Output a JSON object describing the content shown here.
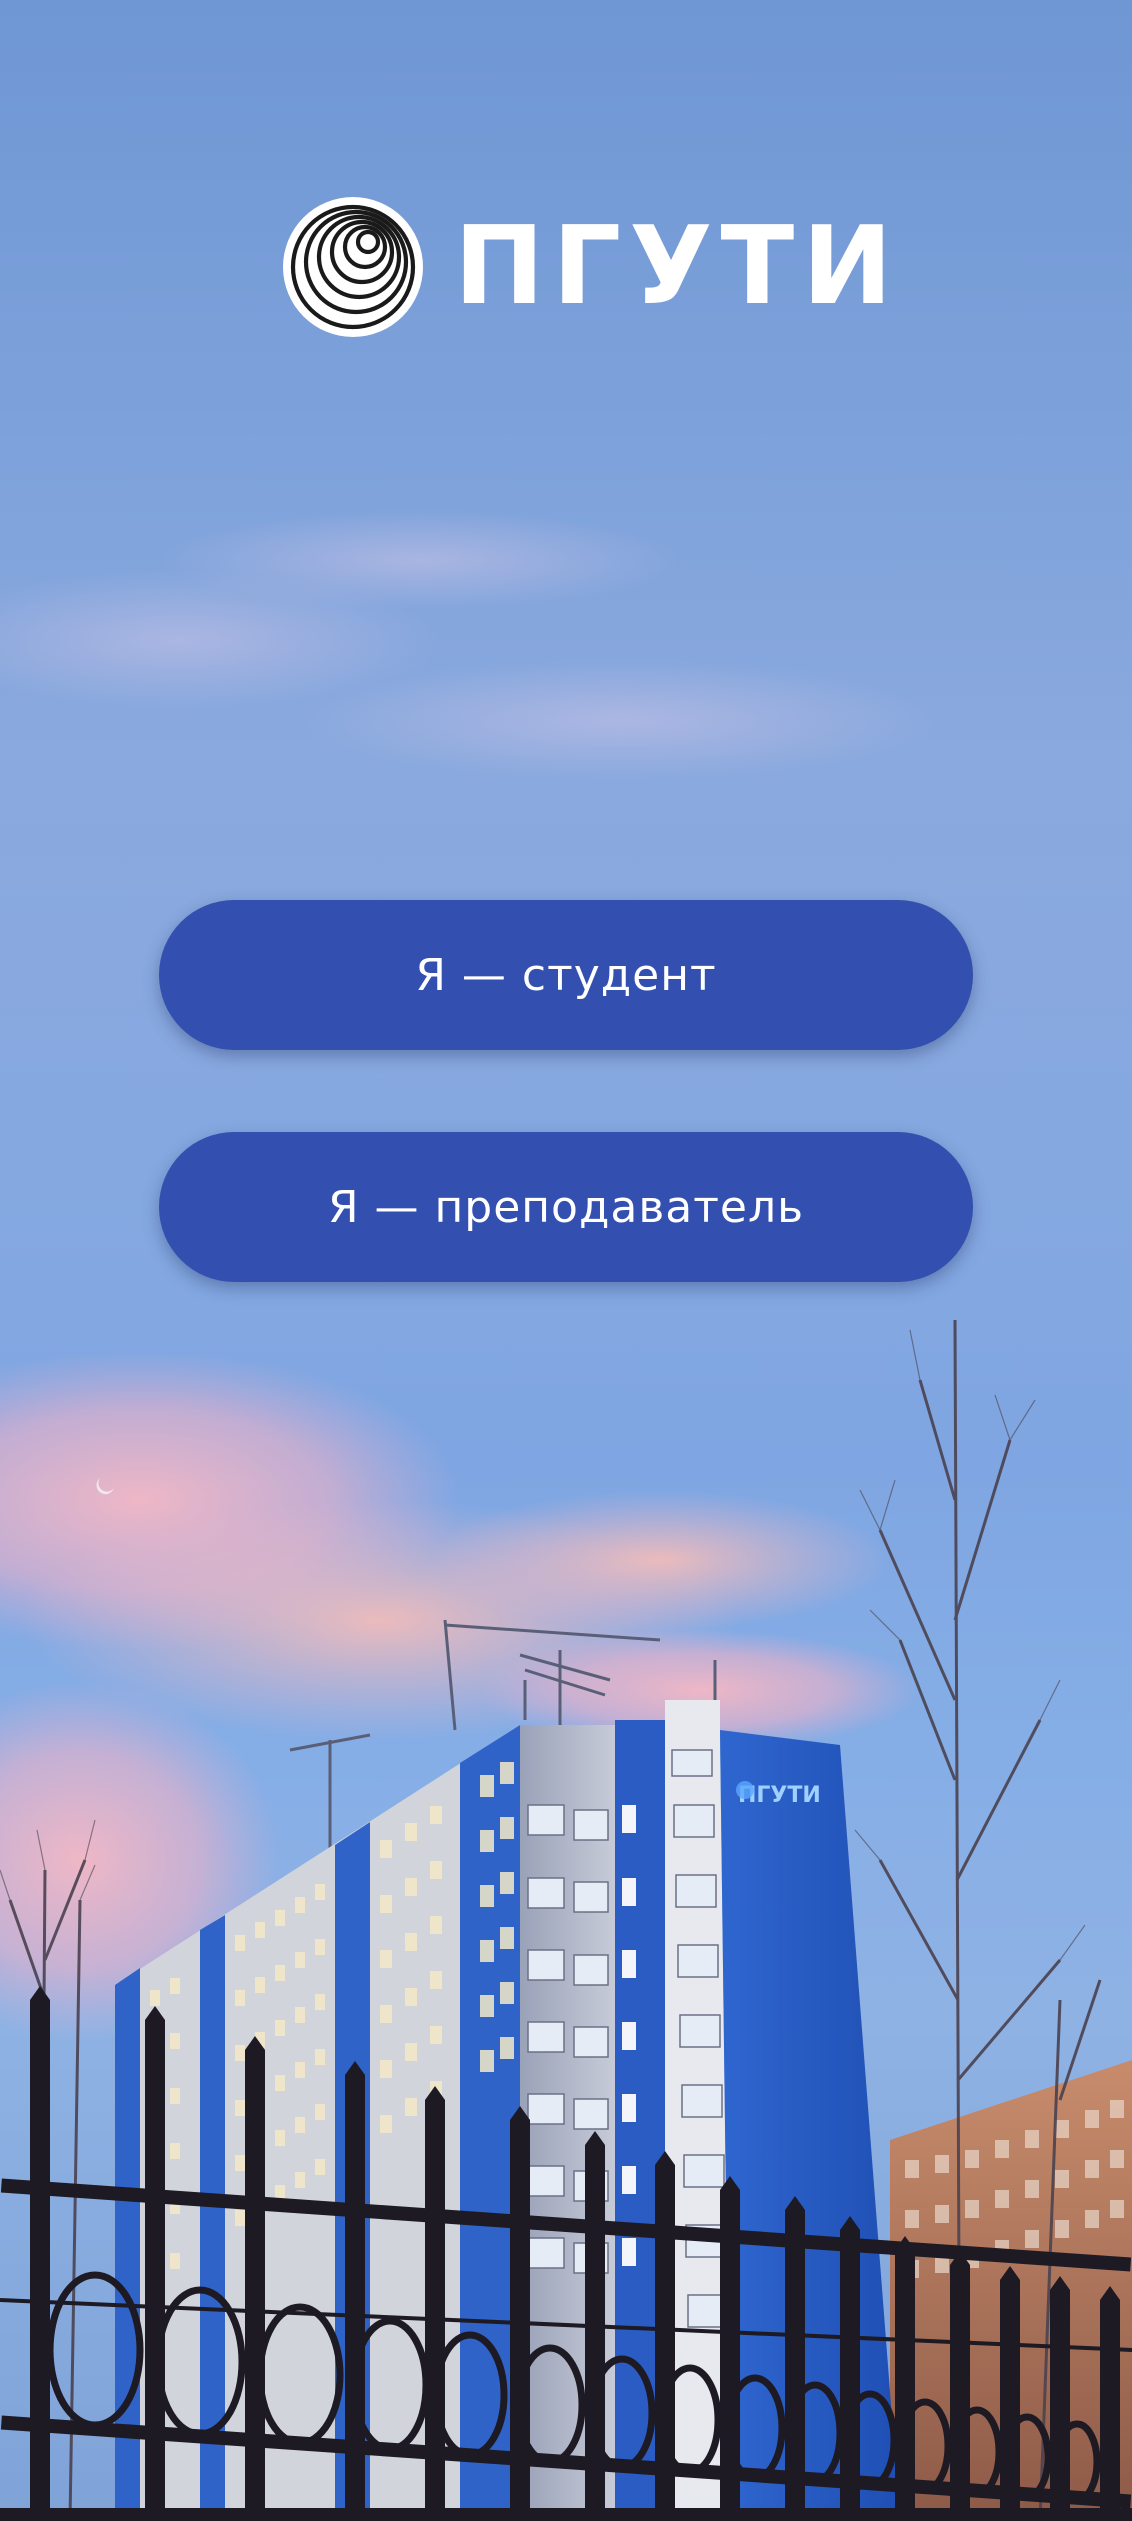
{
  "app": {
    "logo_text": "ПГУТИ",
    "building_sign": "ПГУТИ"
  },
  "buttons": {
    "student_label": "Я — студент",
    "teacher_label": "Я — преподаватель"
  },
  "colors": {
    "button_bg": "#334fb0",
    "button_text": "#ffffff",
    "sky_top": "#6f97d4",
    "cloud_pink": "#f0b3c0",
    "building_blue": "#2a5cc4"
  },
  "icons": {
    "logo": "concentric-circles-logo-icon"
  }
}
